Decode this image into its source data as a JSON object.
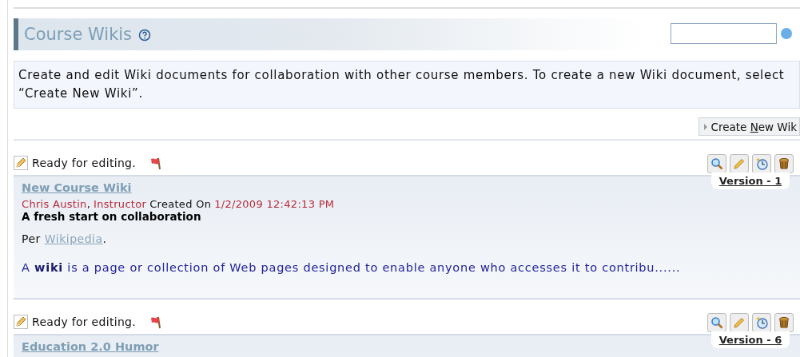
{
  "header": {
    "title": "Course Wikis"
  },
  "description": "Create and edit Wiki documents for collaboration with other course members. To create a new Wiki document, select “Create New Wiki”.",
  "create_button": {
    "label_before": "Create ",
    "accesskey": "N",
    "label_after": "ew Wik"
  },
  "wikis": [
    {
      "status": "Ready for editing.",
      "version": "Version - 1",
      "title": "New Course Wiki",
      "author": "Chris Austin",
      "separator": ",",
      "role": "Instructor",
      "created_label": "Created On",
      "date": "1/2/2009 12:42:13 PM",
      "subtitle": "A fresh start on collaboration",
      "intro": {
        "before": "Per",
        "link": "Wikipedia",
        "after": "."
      },
      "excerpt": "A **wiki** is a page or collection of Web pages designed to enable anyone who accesses it to contribu......"
    },
    {
      "status": "Ready for editing.",
      "version": "Version - 6",
      "title": "Education 2.0 Humor"
    }
  ]
}
